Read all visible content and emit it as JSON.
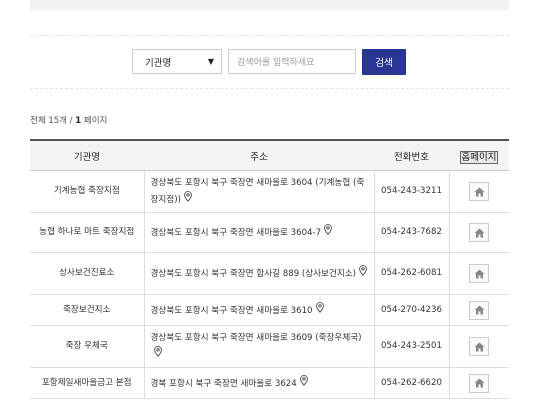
{
  "search": {
    "select_value": "기관명",
    "placeholder": "검색어를 입력하세요",
    "button_label": "검색"
  },
  "summary": {
    "prefix": "전체 15개 / ",
    "page": "1",
    "suffix": " 페이지"
  },
  "table": {
    "headers": [
      "기관명",
      "주소",
      "전화번호",
      "홈페이지"
    ],
    "rows": [
      {
        "name": "기계농협 죽장지점",
        "address": "경상북도 포항시 북구 죽장면 새마을로 3604 (기계농협 (죽장지점))",
        "phone": "054-243-3211"
      },
      {
        "name": "농협 하나로 마트 죽장지점",
        "address": "경상북도 포항시 북구 죽장면 새마을로 3604-7",
        "phone": "054-243-7682"
      },
      {
        "name": "상사보건진료소",
        "address": "경상북도 포항시 북구 죽장면 합사길 889 (상사보건지소)",
        "phone": "054-262-6081"
      },
      {
        "name": "죽장보건지소",
        "address": "경상북도 포항시 북구 죽장면 새마을로 3610",
        "phone": "054-270-4236"
      },
      {
        "name": "죽장 우체국",
        "address": "경상북도 포항시 북구 죽장면 새마을로 3609 (죽장우체국)",
        "phone": "054-243-2501"
      },
      {
        "name": "포항제일새마을금고 본점",
        "address": "경북 포항시 북구 죽장면 새마을로 3624",
        "phone": "054-262-6620"
      }
    ]
  },
  "icons": {
    "map": "map-pin-icon",
    "home": "home-icon"
  },
  "colors": {
    "search_button": "#283593",
    "header_bg": "#f4f4f4"
  }
}
